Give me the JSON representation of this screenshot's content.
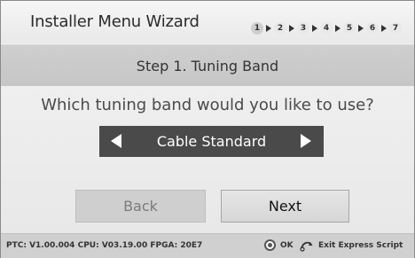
{
  "header": {
    "title": "Installer Menu Wizard",
    "steps": [
      "1",
      "2",
      "3",
      "4",
      "5",
      "6",
      "7"
    ],
    "active_step": "1"
  },
  "band": {
    "title": "Step 1. Tuning Band"
  },
  "question": "Which tuning band would you like to use?",
  "selector": {
    "value": "Cable Standard",
    "left_icon": "arrow-left-icon",
    "right_icon": "arrow-right-icon"
  },
  "buttons": {
    "back": "Back",
    "next": "Next"
  },
  "footer": {
    "version": "PTC: V1.00.004 CPU: V03.19.00 FPGA: 20E7",
    "ok_label": "OK",
    "exit_label": "Exit Express Script",
    "ok_icon": "ok-circle-icon",
    "exit_icon": "return-arrow-icon"
  },
  "colors": {
    "selector_bg": "#4a4a4a",
    "band_bg": "#c9c9c9",
    "footer_bg": "#d0d0d0"
  }
}
